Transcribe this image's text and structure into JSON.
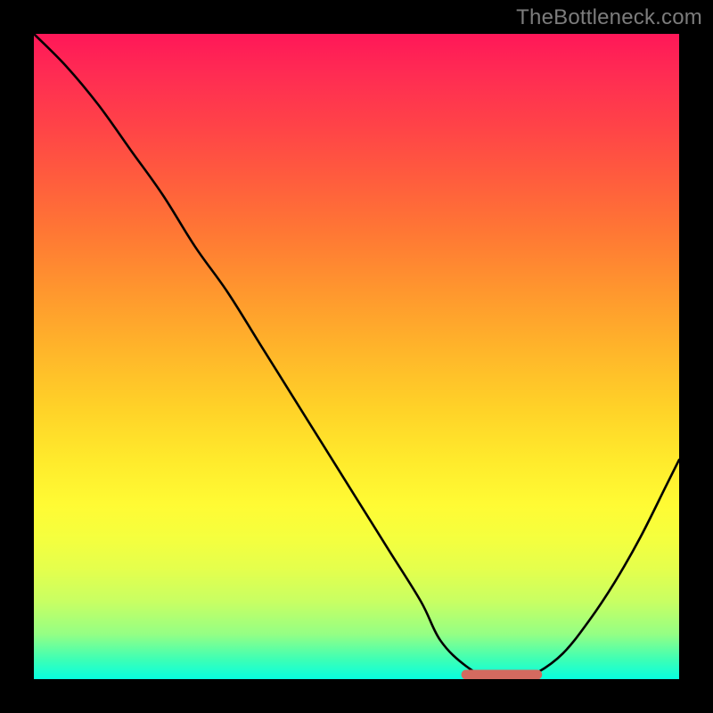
{
  "watermark": "TheBottleneck.com",
  "colors": {
    "frame": "#000000",
    "curve": "#000000",
    "flat_segment": "#d46a5f",
    "gradient_top": "#ff1758",
    "gradient_bottom": "#07ffe0"
  },
  "chart_data": {
    "type": "line",
    "title": "",
    "xlabel": "",
    "ylabel": "",
    "xlim": [
      0,
      100
    ],
    "ylim": [
      0,
      100
    ],
    "series": [
      {
        "name": "bottleneck-curve",
        "x": [
          0,
          5,
          10,
          15,
          20,
          25,
          30,
          35,
          40,
          45,
          50,
          55,
          60,
          63,
          67,
          71,
          75,
          78,
          82,
          86,
          90,
          94,
          98,
          100
        ],
        "values": [
          100,
          95,
          89,
          82,
          75,
          67,
          60,
          52,
          44,
          36,
          28,
          20,
          12,
          6,
          2,
          0,
          0,
          1,
          4,
          9,
          15,
          22,
          30,
          34
        ]
      }
    ],
    "annotations": [
      {
        "name": "flat-min-segment",
        "x_start": 67,
        "x_end": 78,
        "y": 0
      }
    ]
  }
}
